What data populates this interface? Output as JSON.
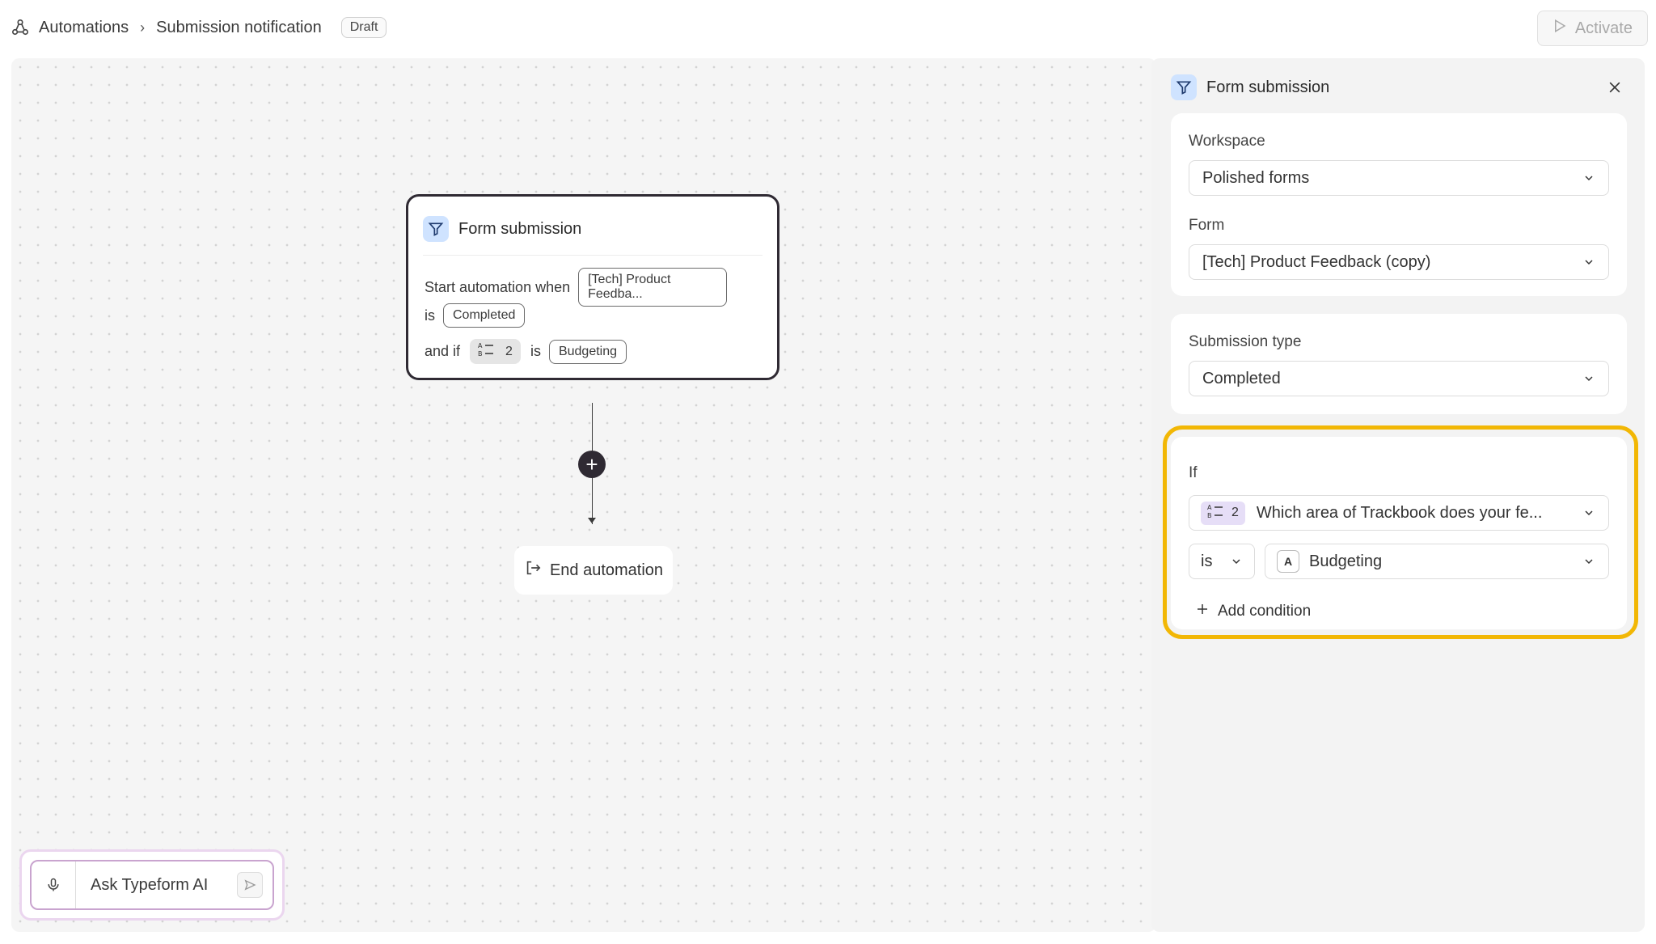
{
  "breadcrumb": {
    "root": "Automations",
    "current": "Submission notification",
    "status": "Draft"
  },
  "header": {
    "activate_label": "Activate"
  },
  "node": {
    "title": "Form submission",
    "row1_label": "Start automation when",
    "row1_value": "[Tech] Product Feedba...",
    "row2_label": "is",
    "row2_value": "Completed",
    "row3_label": "and if",
    "row3_num": "2",
    "row3_is": "is",
    "row3_value": "Budgeting"
  },
  "end_label": "End automation",
  "ai": {
    "placeholder": "Ask Typeform AI"
  },
  "panel": {
    "title": "Form submission",
    "workspace_label": "Workspace",
    "workspace_value": "Polished forms",
    "form_label": "Form",
    "form_value": "[Tech] Product Feedback (copy)",
    "submission_label": "Submission type",
    "submission_value": "Completed",
    "if_label": "If",
    "question_num": "2",
    "question_value": "Which area of Trackbook does your fe...",
    "operator": "is",
    "answer_letter": "A",
    "answer_value": "Budgeting",
    "add_condition": "Add condition"
  },
  "colors": {
    "accent_highlight": "#f2b705",
    "node_border": "#2f2a33",
    "tag_bg": "#cfe3ff",
    "qchip_bg": "#e6def7"
  },
  "icons": [
    "automation-icon",
    "chevron-right-icon",
    "play-icon",
    "funnel-icon",
    "ranking-icon",
    "plus-icon",
    "exit-icon",
    "mic-icon",
    "send-icon",
    "close-icon",
    "chevron-down-icon"
  ]
}
